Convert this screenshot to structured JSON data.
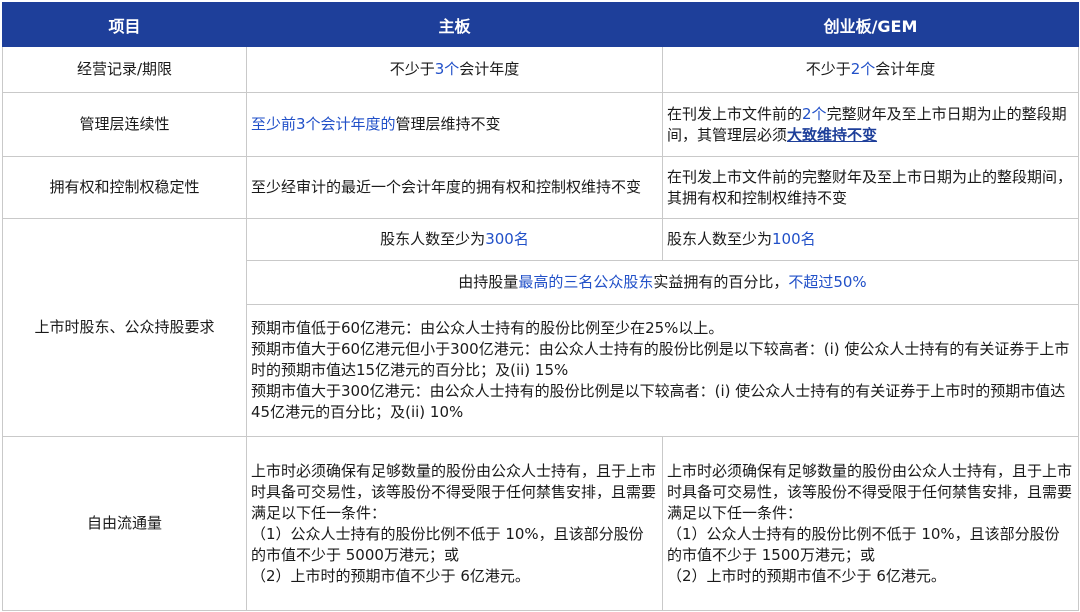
{
  "header": {
    "col_item": "项目",
    "col_main": "主板",
    "col_gem": "创业板/GEM"
  },
  "rows": {
    "track_record": {
      "label": "经营记录/期限",
      "main": {
        "pre": "不少于",
        "em": "3个",
        "post": "会计年度"
      },
      "gem": {
        "pre": "不少于",
        "em": "2个",
        "post": "会计年度"
      }
    },
    "management": {
      "label": "管理层连续性",
      "main": {
        "em": "至少前3个会计年度的",
        "post": "管理层维持不变"
      },
      "gem": {
        "pre": "在刊发上市文件前的",
        "em": "2个",
        "mid": "完整财年及至上市日期为止的整段期间，其管理层必须",
        "strong": "大致维持不变"
      }
    },
    "ownership": {
      "label": "拥有权和控制权稳定性",
      "main": "至少经审计的最近一个会计年度的拥有权和控制权维持不变",
      "gem": "在刊发上市文件前的完整财年及至上市日期为止的整段期间，其拥有权和控制权维持不变"
    },
    "shareholders": {
      "label": "上市时股东、公众持股要求",
      "count_main": {
        "pre": "股东人数至少为",
        "em": "300名"
      },
      "count_gem": {
        "pre": "股东人数至少为",
        "em": "100名"
      },
      "top3": {
        "pre": "由持股量",
        "em1": "最高的三名公众股东",
        "mid": "实益拥有的百分比，",
        "em2": "不超过50%"
      },
      "public_float_lines": [
        "预期市值低于60亿港元：由公众人士持有的股份比例至少在25%以上。",
        "预期市值大于60亿港元但小于300亿港元：由公众人士持有的股份比例是以下较高者：(i) 使公众人士持有的有关证券于上市时的预期市值达15亿港元的百分比；及(ii) 15%",
        "预期市值大于300亿港元：由公众人士持有的股份比例是以下较高者：(i) 使公众人士持有的有关证券于上市时的预期市值达45亿港元的百分比；及(ii) 10%"
      ]
    },
    "free_float": {
      "label": "自由流通量",
      "main": {
        "intro": "上市时必须确保有足够数量的股份由公众人士持有，且于上市时具备可交易性，该等股份不得受限于任何禁售安排，且需要满足以下任一条件：",
        "cond1": "（1）公众人士持有的股份比例不低于 10%，且该部分股份的市值不少于 5000万港元；或",
        "cond2": "（2）上市时的预期市值不少于 6亿港元。"
      },
      "gem": {
        "intro": "上市时必须确保有足够数量的股份由公众人士持有，且于上市时具备可交易性，该等股份不得受限于任何禁售安排，且需要满足以下任一条件：",
        "cond1": "（1）公众人士持有的股份比例不低于 10%，且该部分股份的市值不少于 1500万港元；或",
        "cond2": "（2）上市时的预期市值不少于 6亿港元。"
      }
    }
  }
}
